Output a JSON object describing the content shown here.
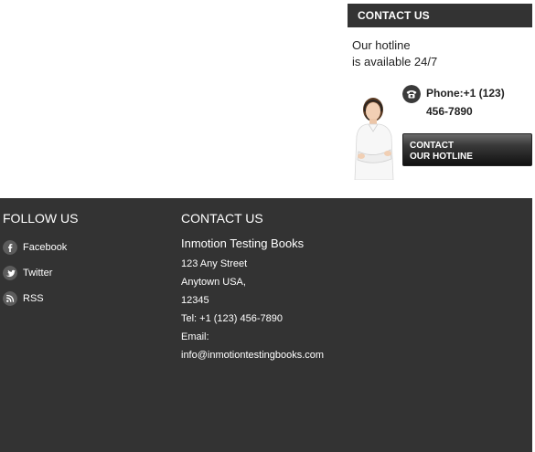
{
  "contact_box": {
    "header": "CONTACT US",
    "hotline_line1": "Our hotline",
    "hotline_line2": "is available 24/7",
    "phone_line1": "Phone:+1 (123)",
    "phone_line2": "456-7890",
    "button_line1": "CONTACT",
    "button_line2": "OUR HOTLINE"
  },
  "footer": {
    "follow_title": "FOLLOW US",
    "social": [
      {
        "label": "Facebook",
        "icon": "facebook-icon"
      },
      {
        "label": "Twitter",
        "icon": "twitter-icon"
      },
      {
        "label": "RSS",
        "icon": "rss-icon"
      }
    ],
    "contact_title": "CONTACT US",
    "company": "Inmotion Testing Books",
    "address": [
      "123 Any Street",
      "Anytown USA,",
      "12345",
      "Tel: +1 (123) 456-7890",
      "Email:",
      "info@inmotiontestingbooks.com"
    ]
  },
  "colors": {
    "footer_bg": "#333333",
    "header_bg": "#333333",
    "text_dark": "#222222"
  }
}
